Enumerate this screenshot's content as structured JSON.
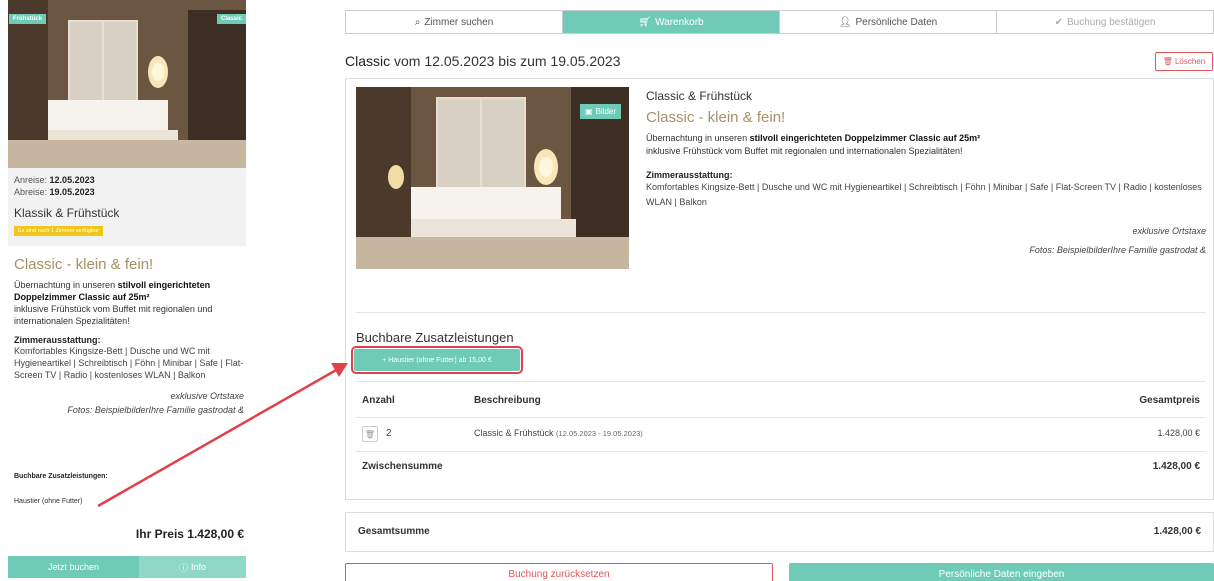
{
  "left_panel": {
    "badge_left": "Frühstück",
    "badge_right": "Classic",
    "arrival_label": "Anreise:",
    "arrival_date": "12.05.2023",
    "departure_label": "Abreise:",
    "departure_date": "19.05.2023",
    "room_name": "Klassik & Frühstück",
    "availability": "Es sind noch 1 Zimmer verfügbar",
    "tagline": "Classic - klein & fein!",
    "text_pre": "Übernachtung in unseren ",
    "text_bold": "stilvoll eingerichteten Doppelzimmer Classic auf 25m²",
    "text_post": "inklusive Frühstück vom Buffet mit regionalen und internationalen Spezialitäten!",
    "equipment_head": "Zimmerausstattung:",
    "equipment": "Komfortables Kingsize-Bett | Dusche und WC mit Hygieneartikel | Schreibtisch | Föhn | Minibar | Safe | Flat-Screen TV | Radio | kostenloses WLAN | Balkon",
    "tax": "exklusive Ortstaxe",
    "photos_credit": "Fotos: BeispielbilderIhre Familie gastrodat &",
    "extras_head": "Buchbare Zusatzleistungen:",
    "extras_item": "Haustier (ohne Futter)",
    "price": "Ihr Preis 1.428,00 €",
    "book_button": "Jetzt buchen",
    "info_button": "Info"
  },
  "steps": [
    {
      "label": "Zimmer suchen",
      "icon": "search-icon"
    },
    {
      "label": "Warenkorb",
      "icon": "cart-icon"
    },
    {
      "label": "Persönliche Daten",
      "icon": "user-icon"
    },
    {
      "label": "Buchung bestätigen",
      "icon": "check-icon"
    }
  ],
  "main": {
    "title_room": "Classic",
    "title_rest": " vom 12.05.2023 bis zum 19.05.2023",
    "delete_button": "Löschen",
    "pictures_button": "Bilder",
    "room_name": "Classic & Frühstück",
    "tagline": "Classic - klein & fein!",
    "text_pre": "Übernachtung in unseren ",
    "text_bold": "stilvoll eingerichteten Doppelzimmer Classic auf 25m²",
    "text_post": "inklusive Frühstück vom Buffet mit regionalen und internationalen Spezialitäten!",
    "equipment_head": "Zimmerausstattung:",
    "equipment": "Komfortables Kingsize-Bett | Dusche und WC mit Hygieneartikel | Schreibtisch | Föhn | Minibar | Safe | Flat-Screen TV | Radio | kostenloses WLAN | Balkon",
    "tax": "exklusive Ortstaxe",
    "photos_credit": "Fotos: BeispielbilderIhre Familie gastrodat &",
    "extras_head": "Buchbare Zusatzleistungen",
    "extra_button": "+ Haustier (ohne Futter)  ab 15,00 €",
    "table": {
      "col_qty": "Anzahl",
      "col_desc": "Beschreibung",
      "col_total": "Gesamtpreis",
      "rows": [
        {
          "qty": "2",
          "desc": "Classic & Frühstück",
          "dates": "(12.05.2023 - 19.05.2023)",
          "total": "1.428,00 €"
        }
      ],
      "subtotal_label": "Zwischensumme",
      "subtotal_value": "1.428,00 €"
    },
    "grand_total_label": "Gesamtsumme",
    "grand_total_value": "1.428,00 €",
    "reset_button": "Buchung zurücksetzen",
    "next_button": "Persönliche Daten eingeben"
  },
  "colors": {
    "accent": "#6fcbb6",
    "danger": "#e05757",
    "tagline": "#a59067",
    "annotation": "#e0414a"
  }
}
